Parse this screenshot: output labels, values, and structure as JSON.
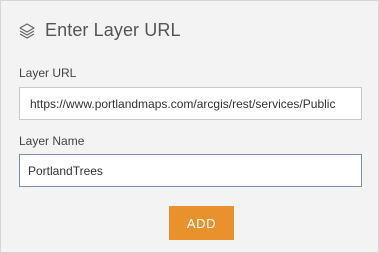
{
  "header": {
    "icon": "layers-icon",
    "title": "Enter Layer URL"
  },
  "layer_url": {
    "label": "Layer URL",
    "value": "https://www.portlandmaps.com/arcgis/rest/services/Public"
  },
  "layer_name": {
    "label": "Layer Name",
    "value": "PortlandTrees"
  },
  "add_button": {
    "label": "ADD",
    "color": "#e8912d"
  }
}
